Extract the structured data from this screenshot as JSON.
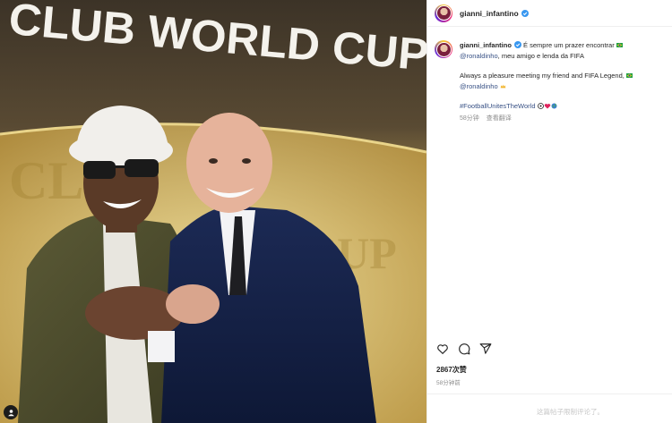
{
  "photo": {
    "backdrop_text": "CLUB WORLD CUP"
  },
  "post": {
    "username": "gianni_infantino",
    "caption_pt": "É sempre um prazer encontrar",
    "mention": "@ronaldinho",
    "caption_pt_rest": ", meu amigo e lenda da FIFA",
    "caption_en": "Always a pleasure meeting my friend and FIFA Legend,",
    "mention2": "@ronaldinho",
    "hashtag": "#FootballUnitesTheWorld",
    "time": "58分钟",
    "translate": "查看翻译",
    "likes": "2867次赞",
    "time_ago": "58分钟前",
    "comments_limited": "这篇帖子限制评论了。"
  },
  "colors": {
    "accent_link": "#385185",
    "verified_blue": "#3897f0",
    "muted_text": "#8e8e8e"
  },
  "icons": [
    "verified-icon",
    "heart-icon",
    "comment-icon",
    "share-icon",
    "tag-user-icon"
  ]
}
